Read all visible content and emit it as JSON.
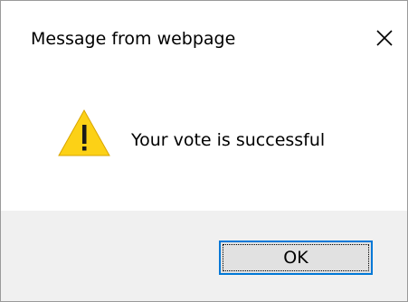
{
  "dialog": {
    "title": "Message from webpage",
    "message": "Your vote is successful",
    "ok_label": "OK",
    "icons": {
      "close": "close-icon",
      "warning": "warning-icon"
    },
    "colors": {
      "accent_border": "#0078d7",
      "warning_fill": "#fcd116",
      "footer_bg": "#f0f0f0"
    }
  }
}
